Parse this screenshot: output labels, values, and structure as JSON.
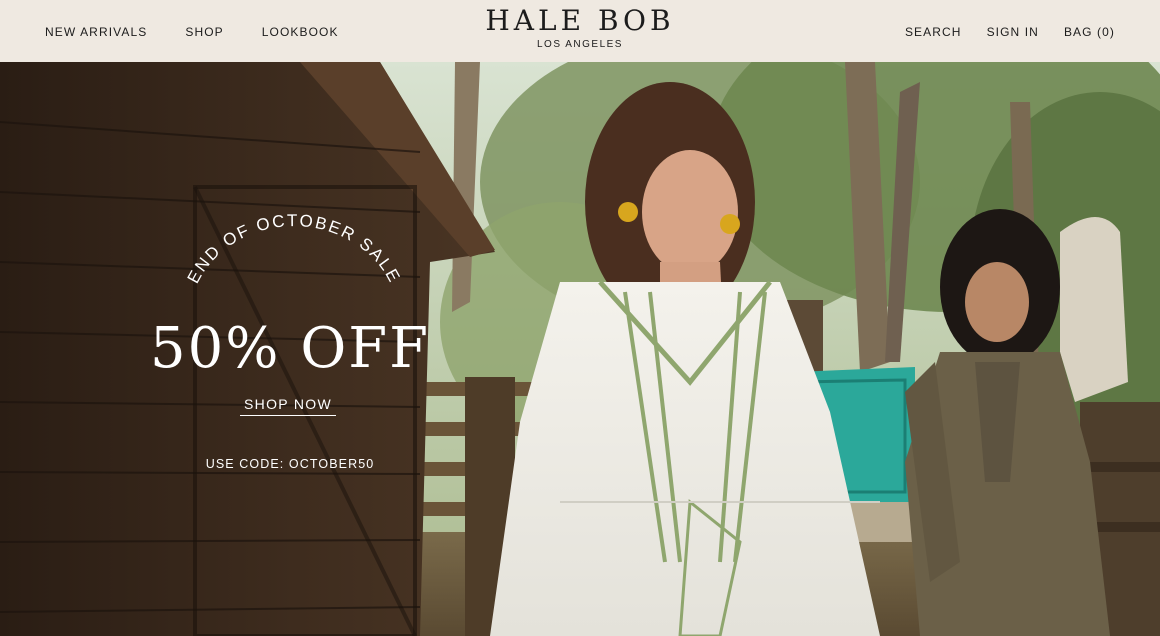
{
  "header": {
    "nav_left": [
      "NEW ARRIVALS",
      "SHOP",
      "LOOKBOOK"
    ],
    "brand_name": "HALE BOB",
    "brand_sub": "LOS ANGELES",
    "nav_right": [
      "SEARCH",
      "SIGN IN",
      "BAG (0)"
    ]
  },
  "hero": {
    "sale_arc": "END OF OCTOBER SALE",
    "discount": "50% OFF",
    "cta": "SHOP NOW",
    "code_text": "USE CODE: OCTOBER50"
  },
  "colors": {
    "header_bg": "#efe9e1",
    "text_dark": "#1c1c1c",
    "hero_text": "#ffffff"
  }
}
